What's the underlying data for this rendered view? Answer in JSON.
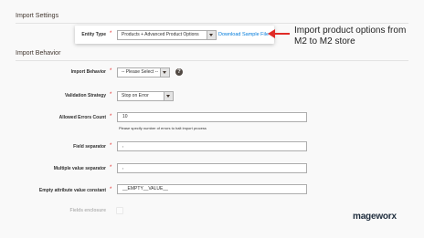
{
  "import_settings": {
    "title": "Import Settings",
    "entity_type_label": "Entity Type",
    "entity_type_value": "Products + Advanced Product Options",
    "download_link": "Download Sample File"
  },
  "callout": {
    "line1": "Import product options from",
    "line2": "M2 to M2 store"
  },
  "import_behavior": {
    "title": "Import Behavior",
    "behavior_label": "Import Behavior",
    "behavior_value": "-- Please Select --",
    "help_glyph": "?",
    "validation_label": "Validation Strategy",
    "validation_value": "Stop on Error",
    "allowed_errors_label": "Allowed Errors Count",
    "allowed_errors_value": "10",
    "allowed_errors_note": "Please specify number of errors to halt import process",
    "field_separator_label": "Field separator",
    "field_separator_value": ",",
    "multi_separator_label": "Multiple value separator",
    "multi_separator_value": ",",
    "empty_attr_label": "Empty attribute value constant",
    "empty_attr_value": "__EMPTY__VALUE__",
    "fields_enclosure_label": "Fields enclosure"
  },
  "required_mark": "*",
  "brand": {
    "logo_text": "mageworx"
  }
}
